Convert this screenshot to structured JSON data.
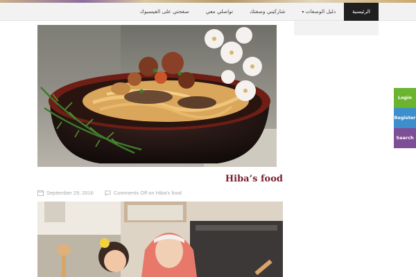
{
  "nav": {
    "items": [
      {
        "label": "الرئيسية",
        "active": true
      },
      {
        "label": "دليل الوصفات",
        "has_dropdown": true
      },
      {
        "label": "شاركيني وصفتك"
      },
      {
        "label": "تواصلي معي"
      },
      {
        "label": "صفحتي على الفيسبوك"
      }
    ]
  },
  "post": {
    "title": "Hiba’s food",
    "date": "September 29, 2016",
    "comments": "Comments Off on Hiba's food"
  },
  "side_buttons": {
    "login": "Login",
    "register": "Register",
    "search": "Search"
  },
  "icons": {
    "date": "calendar-icon",
    "comments": "comment-bubble-icon",
    "dropdown": "chevron-down-icon"
  },
  "colors": {
    "nav_active_bg": "#1f1f1f",
    "title": "#7a2030",
    "meta": "#a9a9a9",
    "login": "#6ab42f",
    "register": "#3c8fcc",
    "search": "#7e4f96"
  }
}
